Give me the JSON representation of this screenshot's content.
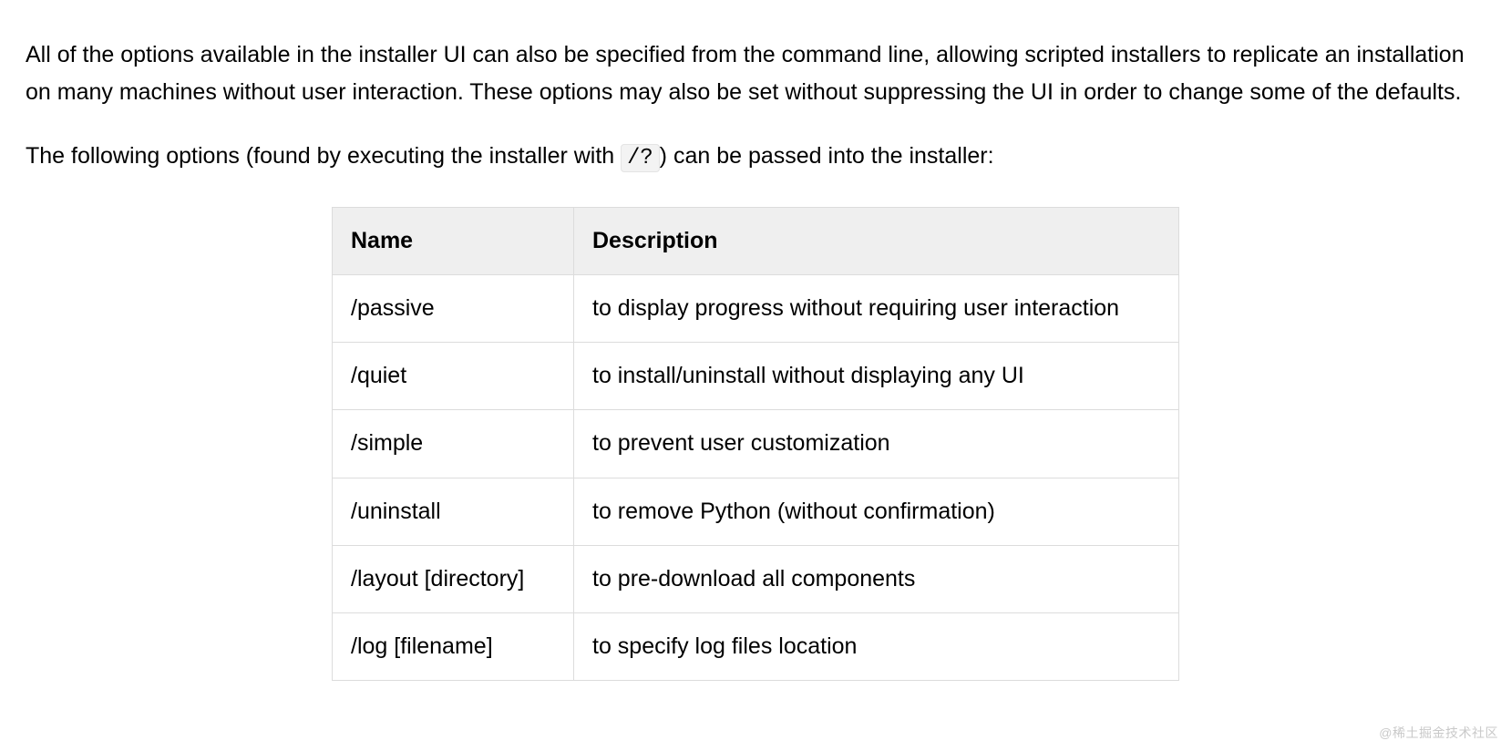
{
  "paragraphs": {
    "p1": "All of the options available in the installer UI can also be specified from the command line, allowing scripted in­stallers to replicate an installation on many machines without user interaction. These options may also be set without suppressing the UI in order to change some of the defaults.",
    "p2_before": "The following options (found by executing the installer with ",
    "p2_code": "/?",
    "p2_after": ") can be passed into the installer:"
  },
  "table": {
    "headers": {
      "name": "Name",
      "description": "Description"
    },
    "rows": [
      {
        "name": "/passive",
        "description": "to display progress without requiring user interaction"
      },
      {
        "name": "/quiet",
        "description": "to install/uninstall without displaying any UI"
      },
      {
        "name": "/simple",
        "description": "to prevent user customization"
      },
      {
        "name": "/uninstall",
        "description": "to remove Python (without confirmation)"
      },
      {
        "name": "/layout [directory]",
        "description": "to pre-download all components"
      },
      {
        "name": "/log [filename]",
        "description": "to specify log files location"
      }
    ]
  },
  "watermark": "@稀土掘金技术社区"
}
